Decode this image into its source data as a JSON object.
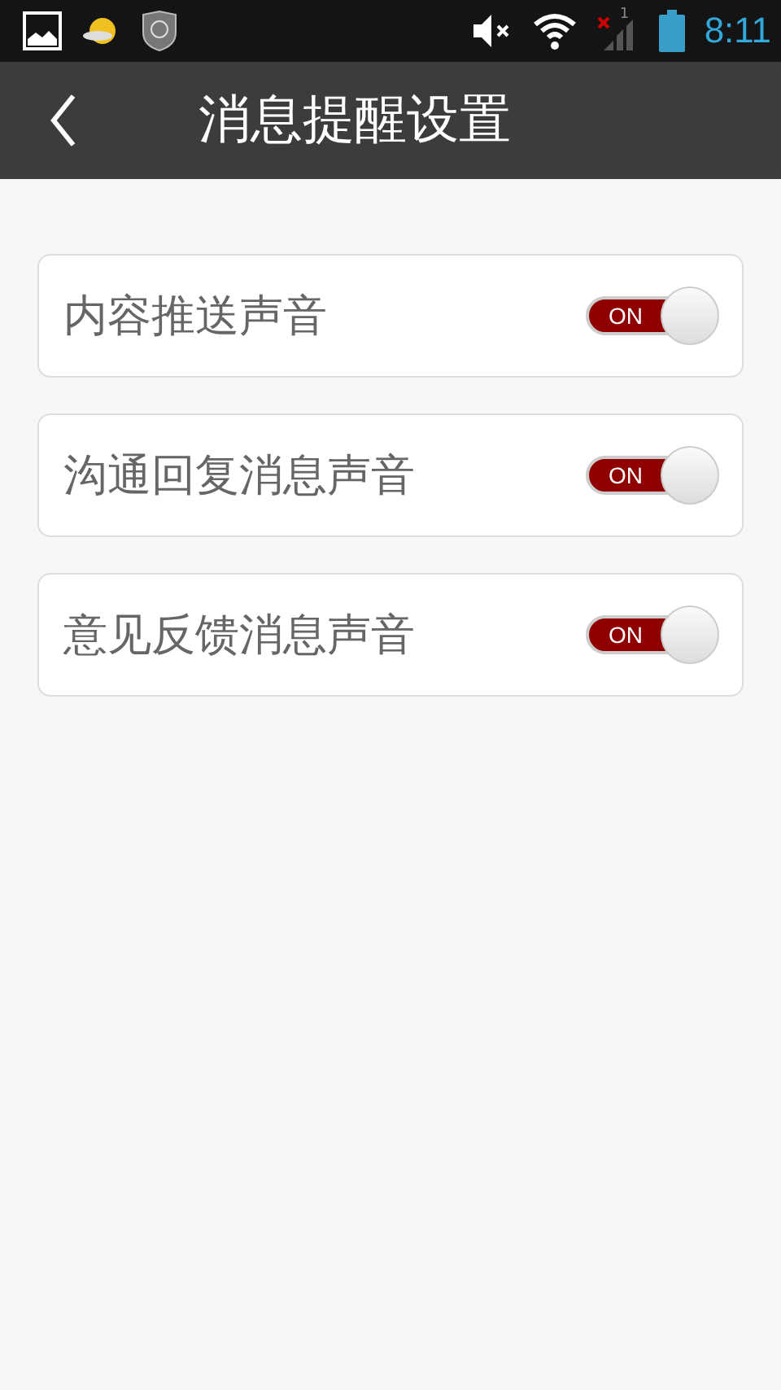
{
  "status_bar": {
    "signal_label": "1",
    "time": "8:11"
  },
  "header": {
    "title": "消息提醒设置"
  },
  "settings": [
    {
      "label": "内容推送声音",
      "on": true,
      "switch_text": "ON"
    },
    {
      "label": "沟通回复消息声音",
      "on": true,
      "switch_text": "ON"
    },
    {
      "label": "意见反馈消息声音",
      "on": true,
      "switch_text": "ON"
    }
  ]
}
